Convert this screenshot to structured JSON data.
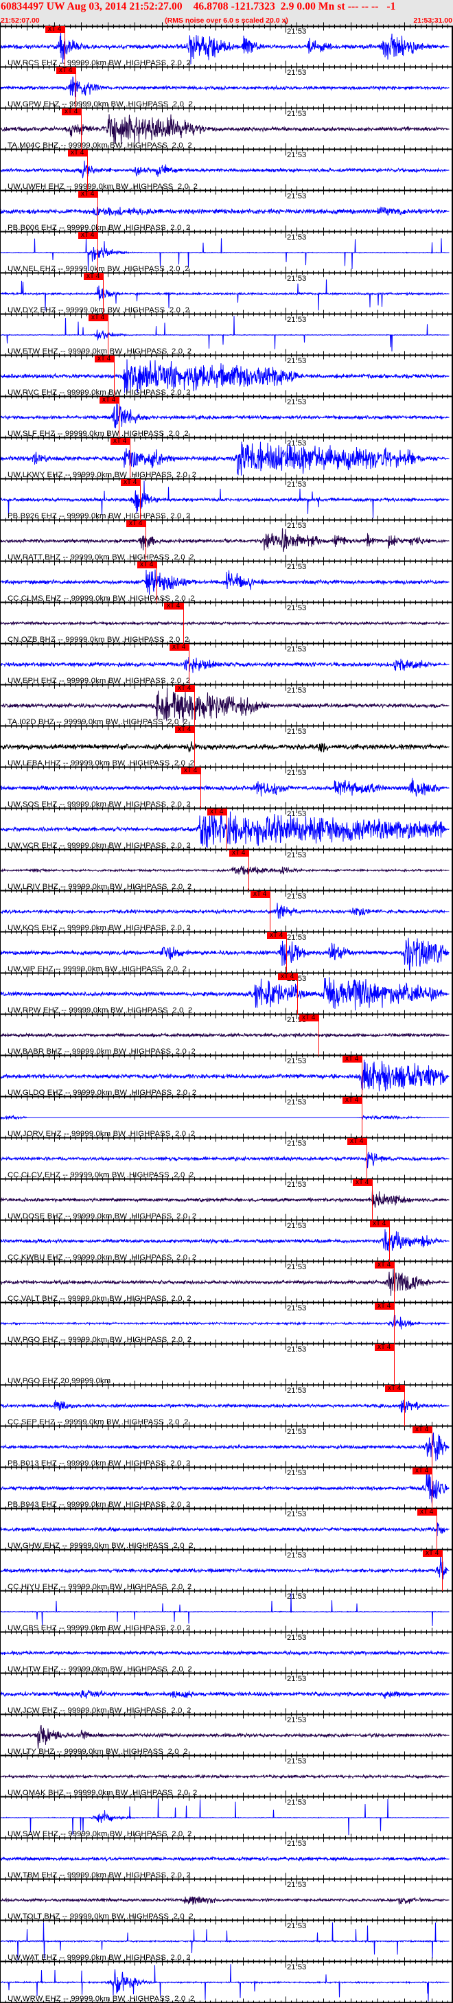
{
  "header": {
    "title": "60834497 UW Aug 03, 2014 21:52:27.00    46.8708 -121.7323  2.9 0.00 Mn st --- -- --   -1",
    "start_time": "21:52:07.00",
    "note": "(RMS noise over 6.0 s scaled 20.0 x)",
    "end_time": "21:53:31.00"
  },
  "time_axis": {
    "span_s": 84,
    "minute_mark_s": 53,
    "minute_label": "21:53",
    "major_tick_s": 5,
    "minor_tick_s": 1
  },
  "pick_label": "xT 4",
  "colors": {
    "ehz": "#0000ff",
    "bhz": "#22004a",
    "hhz": "#000000",
    "pick": "#ff0000",
    "header_text": "#ff0000",
    "header_bg": "#e6e6e6"
  },
  "panels": [
    {
      "label": "UW.RCS EHZ -- 99999.0km BW .HIGHPASS  2.0  2",
      "color": "ehz",
      "pick_s": 12.0,
      "style": "noise",
      "noise": 0.12,
      "bursts": [
        [
          11,
          2,
          1.0
        ],
        [
          35,
          3,
          1.0
        ],
        [
          38,
          3,
          1.0
        ],
        [
          45,
          2,
          0.6
        ],
        [
          57,
          4,
          0.5
        ],
        [
          71,
          5,
          0.9
        ],
        [
          76,
          1,
          0.9
        ]
      ]
    },
    {
      "label": "UW.GPW EHZ -- 99999.0km BW .HIGHPASS  2.0  2",
      "color": "ehz",
      "pick_s": 14.0,
      "style": "noise",
      "noise": 0.1,
      "bursts": [
        [
          13,
          3,
          0.9
        ]
      ]
    },
    {
      "label": "TA.M04C BHZ -- 99999.0km BW .HIGHPASS  2.0  2",
      "color": "bhz",
      "pick_s": 15.0,
      "style": "noise",
      "noise": 0.12,
      "bursts": [
        [
          13,
          3,
          0.5
        ],
        [
          20,
          11,
          1.0
        ],
        [
          31,
          5,
          0.8
        ]
      ]
    },
    {
      "label": "UW.UWFH EHZ -- 99999.0km BW .HIGHPASS  2.0  2",
      "color": "ehz",
      "pick_s": 16.2,
      "style": "noise",
      "noise": 0.1,
      "bursts": [
        [
          15,
          1.5,
          0.7
        ],
        [
          25,
          2,
          0.4
        ],
        [
          29,
          2,
          0.6
        ]
      ]
    },
    {
      "label": "PB.B006 EHZ -- 99999.0km BW .HIGHPASS  2.0  2",
      "color": "ehz",
      "pick_s": 18.1,
      "style": "noise",
      "noise": 0.14,
      "bursts": [
        [
          17,
          12,
          0.3
        ],
        [
          70,
          7,
          0.25
        ]
      ]
    },
    {
      "label": "UW.NEL EHZ -- 99999.0km BW .HIGHPASS  2.0  2",
      "color": "ehz",
      "pick_s": 18.1,
      "style": "spiky",
      "noise": 0.02,
      "bursts": [
        [
          17,
          3,
          0.5
        ]
      ]
    },
    {
      "label": "UW.DY2 EHZ -- 99999.0km BW .HIGHPASS  2.0  2",
      "color": "ehz",
      "pick_s": 19.1,
      "style": "spiky",
      "noise": 0.06,
      "bursts": [
        [
          18,
          2,
          0.5
        ]
      ]
    },
    {
      "label": "UW.ETW EHZ -- 99999.0km BW .HIGHPASS  2.0  2",
      "color": "ehz",
      "pick_s": 20.0,
      "style": "spiky",
      "noise": 0.02,
      "bursts": [
        [
          18,
          2,
          0.4
        ]
      ]
    },
    {
      "label": "UW.RVC EHZ -- 99999.0km BW .HIGHPASS  2.0  2",
      "color": "ehz",
      "pick_s": 21.1,
      "style": "noise",
      "noise": 0.12,
      "bursts": [
        [
          23,
          30,
          1.0
        ]
      ]
    },
    {
      "label": "UW.SLF EHZ -- 99999.0km BW .HIGHPASS  2.0  2",
      "color": "ehz",
      "pick_s": 22.0,
      "style": "noise",
      "noise": 0.1,
      "bursts": [
        [
          21,
          3,
          1.0
        ]
      ]
    },
    {
      "label": "UW.LKWY EHZ -- 99999.0km BW .HIGHPASS  2.0  2",
      "color": "ehz",
      "pick_s": 24.1,
      "style": "noise",
      "noise": 0.12,
      "bursts": [
        [
          6,
          2,
          0.5
        ],
        [
          23,
          5,
          0.7
        ],
        [
          28,
          3,
          0.6
        ],
        [
          44,
          32,
          1.0
        ]
      ]
    },
    {
      "label": "PB.B926 EHZ -- 99999.0km BW .HIGHPASS  2.0  2",
      "color": "ehz",
      "pick_s": 26.0,
      "style": "spikynoise",
      "noise": 0.1,
      "bursts": [
        [
          25,
          1.5,
          1.0
        ]
      ]
    },
    {
      "label": "UW.RATT BHZ -- 99999.0km BW .HIGHPASS  2.0  2",
      "color": "bhz",
      "pick_s": 27.0,
      "style": "noise",
      "noise": 0.1,
      "bursts": [
        [
          26,
          2,
          0.6
        ],
        [
          49,
          2,
          0.7
        ],
        [
          52,
          3,
          0.8
        ],
        [
          57,
          2,
          0.5
        ],
        [
          62,
          1,
          0.7
        ],
        [
          68,
          1,
          0.5
        ],
        [
          72,
          2,
          0.4
        ],
        [
          76,
          2,
          0.5
        ]
      ]
    },
    {
      "label": "CC.CLMS EHZ -- 99999.0km BW .HIGHPASS  2.0  2",
      "color": "ehz",
      "pick_s": 29.0,
      "style": "noise",
      "noise": 0.12,
      "bursts": [
        [
          27,
          6,
          0.8
        ],
        [
          42,
          3,
          0.7
        ],
        [
          46,
          1,
          0.5
        ]
      ]
    },
    {
      "label": "CN.OZB BHZ -- 99999.0km BW .HIGHPASS  2.0  2",
      "color": "bhz",
      "pick_s": 34.0,
      "style": "noise",
      "noise": 0.08,
      "bursts": []
    },
    {
      "label": "UW.EPH EHZ -- 99999.0km BW .HIGHPASS  2.0  2",
      "color": "ehz",
      "pick_s": 35.0,
      "style": "noise",
      "noise": 0.12,
      "bursts": [
        [
          34,
          5,
          0.6
        ],
        [
          73,
          6,
          0.4
        ]
      ]
    },
    {
      "label": "TA.I02D BHZ -- 99999.0km BW .HIGHPASS  2.0  2",
      "color": "bhz",
      "pick_s": 36.0,
      "style": "noise",
      "noise": 0.12,
      "bursts": [
        [
          29,
          18,
          1.0
        ]
      ]
    },
    {
      "label": "UW.LEBA HHZ -- 99999.0km BW .HIGHPASS  2.0  2",
      "color": "hhz",
      "pick_s": 36.0,
      "style": "noise",
      "noise": 0.15,
      "bursts": [
        [
          35,
          2,
          0.4
        ],
        [
          59,
          2,
          0.4
        ]
      ]
    },
    {
      "label": "UW.SOS EHZ -- 99999.0km BW .HIGHPASS  2.0  2",
      "color": "ehz",
      "pick_s": 37.2,
      "style": "noise",
      "noise": 0.12,
      "bursts": [
        [
          47,
          5,
          0.6
        ],
        [
          62,
          8,
          0.5
        ],
        [
          76,
          4,
          0.6
        ]
      ]
    },
    {
      "label": "UW.VCR EHZ -- 99999.0km BW .HIGHPASS  2.0  2",
      "color": "ehz",
      "pick_s": 42.0,
      "style": "noise",
      "noise": 0.12,
      "bursts": [
        [
          37,
          45,
          1.0
        ]
      ]
    },
    {
      "label": "UW.LRIV BHZ -- 99999.0km BW .HIGHPASS  2.0  2",
      "color": "bhz",
      "pick_s": 46.1,
      "style": "noise",
      "noise": 0.06,
      "bursts": [
        [
          6,
          2,
          0.2
        ],
        [
          43,
          7,
          0.3
        ],
        [
          52,
          2,
          0.3
        ]
      ]
    },
    {
      "label": "UW.KOS EHZ -- 99999.0km BW .HIGHPASS  2.0  2",
      "color": "ehz",
      "pick_s": 50.0,
      "style": "noise",
      "noise": 0.1,
      "bursts": [
        [
          51,
          3,
          0.5
        ],
        [
          65,
          2,
          0.5
        ]
      ]
    },
    {
      "label": "UW.VIP EHZ -- 99999.0km BW .HIGHPASS  2.0  2",
      "color": "ehz",
      "pick_s": 53.1,
      "style": "noise",
      "noise": 0.12,
      "bursts": [
        [
          30,
          3,
          0.6
        ],
        [
          52,
          3,
          0.9
        ],
        [
          61,
          3,
          0.6
        ],
        [
          75,
          8,
          1.0
        ]
      ]
    },
    {
      "label": "UW.RPW EHZ -- 99999.0km BW .HIGHPASS  2.0  2",
      "color": "ehz",
      "pick_s": 55.1,
      "style": "noise",
      "noise": 0.12,
      "bursts": [
        [
          47,
          8,
          1.0
        ],
        [
          60,
          20,
          1.0
        ]
      ]
    },
    {
      "label": "UW.BABR BHZ -- 99999.0km BW .HIGHPASS  2.0  2",
      "color": "bhz",
      "pick_s": 59.1,
      "style": "noise",
      "noise": 0.1,
      "bursts": []
    },
    {
      "label": "UW.GLDO EHZ -- 99999.0km BW .HIGHPASS  2.0  2",
      "color": "ehz",
      "pick_s": 67.1,
      "style": "noise",
      "noise": 0.12,
      "bursts": [
        [
          67,
          16,
          1.0
        ]
      ]
    },
    {
      "label": "UW.JORV EHZ -- 99999.0km BW .HIGHPASS  2.0  2",
      "color": "ehz",
      "pick_s": 67.1,
      "style": "flat",
      "noise": 0.01,
      "bursts": [
        [
          0,
          4,
          0.15
        ],
        [
          67,
          10,
          0.12
        ]
      ]
    },
    {
      "label": "CC.CLCV EHZ -- 99999.0km BW .HIGHPASS  2.0  2",
      "color": "ehz",
      "pick_s": 68.0,
      "style": "noise",
      "noise": 0.1,
      "bursts": [
        [
          68,
          2,
          0.6
        ]
      ]
    },
    {
      "label": "UW.DOSE BHZ -- 99999.0km BW .HIGHPASS  2.0  2",
      "color": "bhz",
      "pick_s": 69.0,
      "style": "noise",
      "noise": 0.1,
      "bursts": [
        [
          69,
          5,
          0.6
        ]
      ]
    },
    {
      "label": "CC.KWBU EHZ -- 99999.0km BW .HIGHPASS  2.0  2",
      "color": "ehz",
      "pick_s": 72.2,
      "style": "noise",
      "noise": 0.1,
      "bursts": [
        [
          71,
          5,
          0.7
        ],
        [
          78,
          2,
          0.5
        ]
      ]
    },
    {
      "label": "CC.VALT BHZ -- 99999.0km BW .HIGHPASS  2.0  2",
      "color": "bhz",
      "pick_s": 73.1,
      "style": "noise",
      "noise": 0.1,
      "bursts": [
        [
          72,
          5,
          0.9
        ]
      ]
    },
    {
      "label": "UW.PGO EHZ -- 99999.0km BW .HIGHPASS  2.0  2",
      "color": "ehz",
      "pick_s": 73.1,
      "style": "noise",
      "noise": 0.06,
      "bursts": [
        [
          73,
          1,
          0.8
        ]
      ]
    },
    {
      "label": "UW.PGO EHZ 20 99999.0km",
      "color": "ehz",
      "pick_s": 73.1,
      "style": "none",
      "noise": 0,
      "bursts": []
    },
    {
      "label": "CC.SEP EHZ -- 99999.0km BW .HIGHPASS  2.0  2",
      "color": "ehz",
      "pick_s": 75.0,
      "style": "noise",
      "noise": 0.1,
      "bursts": [
        [
          10,
          3,
          0.4
        ],
        [
          74,
          3,
          0.5
        ]
      ]
    },
    {
      "label": "PB.B013 EHZ -- 99999.0km BW .HIGHPASS  2.0  2",
      "color": "ehz",
      "pick_s": 80.1,
      "style": "noise",
      "noise": 0.1,
      "bursts": [
        [
          79,
          4,
          1.0
        ]
      ]
    },
    {
      "label": "PB.B943 EHZ -- 99999.0km BW .HIGHPASS  2.0  2",
      "color": "ehz",
      "pick_s": 80.1,
      "style": "noise",
      "noise": 0.1,
      "bursts": [
        [
          79,
          4,
          1.0
        ]
      ]
    },
    {
      "label": "UW.GHW EHZ -- 99999.0km BW .HIGHPASS  2.0  2",
      "color": "ehz",
      "pick_s": 81.0,
      "style": "noise",
      "noise": 0.1,
      "bursts": [
        [
          81,
          2,
          0.5
        ]
      ]
    },
    {
      "label": "CC.HIYU EHZ -- 99999.0km BW .HIGHPASS  2.0  2",
      "color": "ehz",
      "pick_s": 82.0,
      "style": "noise",
      "noise": 0.1,
      "bursts": [
        [
          81.5,
          1.5,
          1.0
        ]
      ]
    },
    {
      "label": "UW.CBS EHZ -- 99999.0km BW .HIGHPASS  2.0  2",
      "color": "ehz",
      "pick_s": null,
      "style": "spiky",
      "noise": 0.02,
      "bursts": []
    },
    {
      "label": "UW.HTW EHZ -- 99999.0km BW .HIGHPASS  2.0  2",
      "color": "ehz",
      "pick_s": null,
      "style": "noise",
      "noise": 0.1,
      "bursts": []
    },
    {
      "label": "UW.JCW EHZ -- 99999.0km BW .HIGHPASS  2.0  2",
      "color": "ehz",
      "pick_s": null,
      "style": "noise",
      "noise": 0.12,
      "bursts": [
        [
          15,
          5,
          0.3
        ],
        [
          32,
          4,
          0.3
        ],
        [
          71,
          4,
          0.3
        ]
      ]
    },
    {
      "label": "UW.LTY BHZ -- 99999.0km BW .HIGHPASS  2.0  2",
      "color": "bhz",
      "pick_s": null,
      "style": "noise",
      "noise": 0.1,
      "bursts": [
        [
          7,
          2,
          0.9
        ],
        [
          15,
          2,
          0.3
        ]
      ]
    },
    {
      "label": "UW.OMAK BHZ -- 99999.0km BW .HIGHPASS  2.0  2",
      "color": "bhz",
      "pick_s": null,
      "style": "noise",
      "noise": 0.08,
      "bursts": []
    },
    {
      "label": "UW.SAW EHZ -- 99999.0km BW .HIGHPASS  2.0  2",
      "color": "ehz",
      "pick_s": null,
      "style": "spiky",
      "noise": 0.02,
      "bursts": [
        [
          18,
          2,
          0.5
        ]
      ]
    },
    {
      "label": "UW.TBM EHZ -- 99999.0km BW .HIGHPASS  2.0  2",
      "color": "ehz",
      "pick_s": null,
      "style": "noise",
      "noise": 0.1,
      "bursts": []
    },
    {
      "label": "UW.TOLT BHZ -- 99999.0km BW .HIGHPASS  2.0  2",
      "color": "bhz",
      "pick_s": null,
      "style": "noise",
      "noise": 0.08,
      "bursts": [
        [
          34,
          6,
          0.3
        ],
        [
          74,
          4,
          0.3
        ]
      ]
    },
    {
      "label": "UW.WAT EHZ -- 99999.0km BW .HIGHPASS  2.0  2",
      "color": "ehz",
      "pick_s": null,
      "style": "spiky",
      "noise": 0.04,
      "bursts": []
    },
    {
      "label": "UW.WRW EHZ -- 99999.0km BW .HIGHPASS  2.0  2",
      "color": "ehz",
      "pick_s": null,
      "style": "spiky",
      "noise": 0.04,
      "bursts": [
        [
          21,
          2.5,
          1.0
        ]
      ]
    }
  ]
}
